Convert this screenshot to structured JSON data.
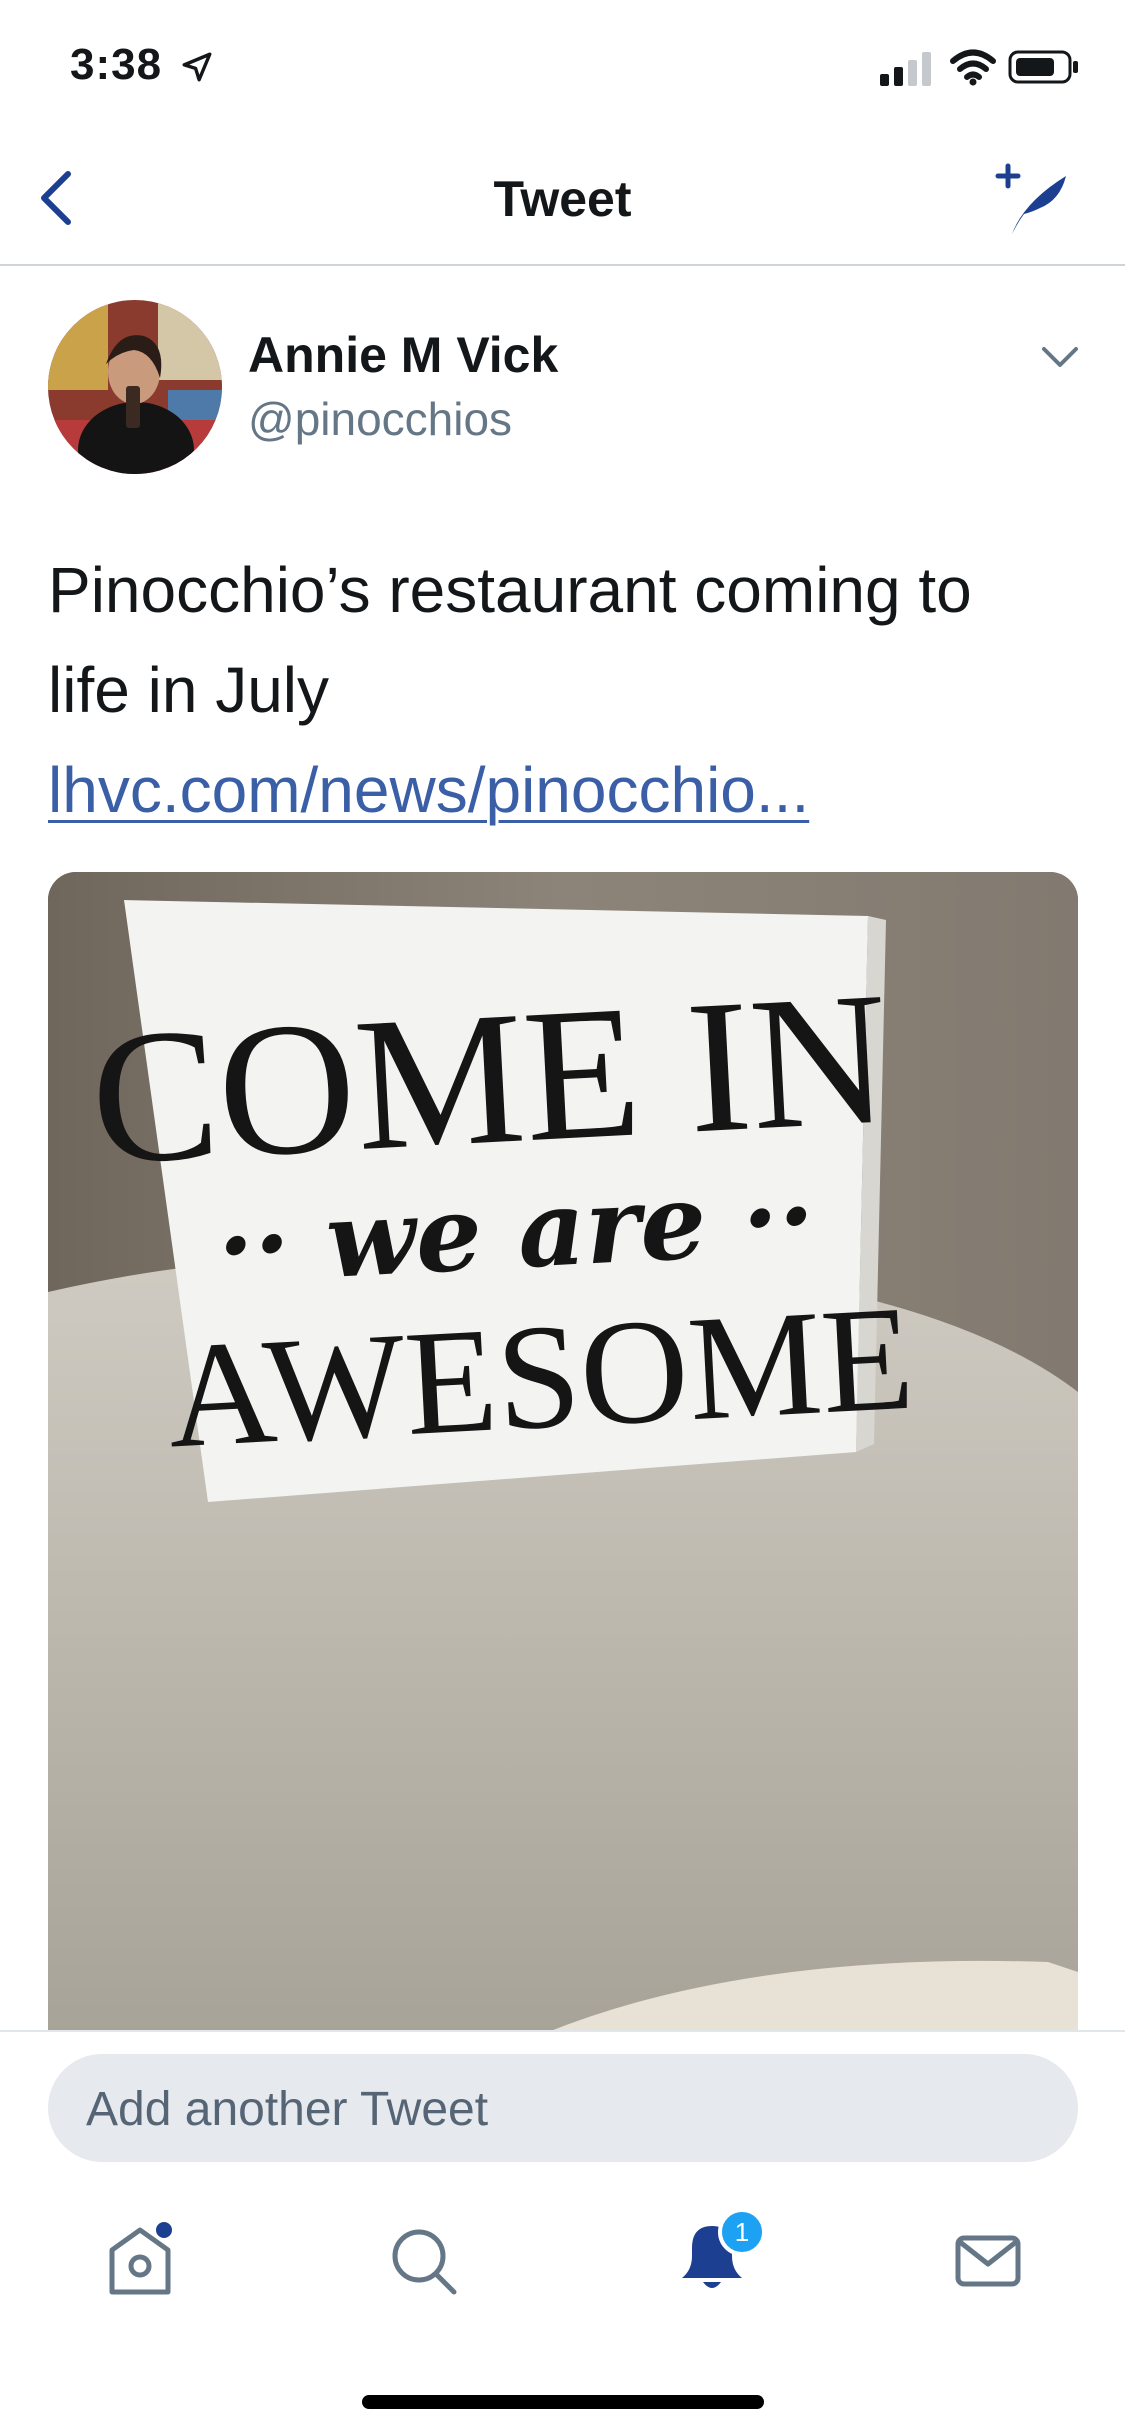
{
  "status_bar": {
    "time": "3:38"
  },
  "nav": {
    "title": "Tweet"
  },
  "tweet": {
    "author": {
      "name": "Annie M Vick",
      "handle": "@pinocchios"
    },
    "text": "Pinocchio’s restaurant coming to life in July ",
    "link": "lhvc.com/news/pinocchio...",
    "media": {
      "sign_line1": "COME IN",
      "sign_line2": "·· we are ··",
      "sign_line3": "AWESOME"
    }
  },
  "reply": {
    "placeholder": "Add another Tweet"
  },
  "tabbar": {
    "notifications_badge": "1"
  },
  "colors": {
    "accent": "#1d3f91",
    "link": "#3b5fa7",
    "badge": "#1da1f2"
  }
}
